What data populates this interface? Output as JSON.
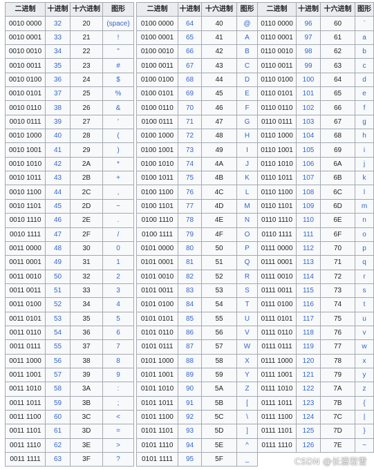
{
  "headers": [
    "二进制",
    "十进制",
    "十六进制",
    "图形"
  ],
  "tables": [
    {
      "rows": [
        [
          "0010 0000",
          "32",
          "20",
          "(space)"
        ],
        [
          "0010 0001",
          "33",
          "21",
          "!"
        ],
        [
          "0010 0010",
          "34",
          "22",
          "\""
        ],
        [
          "0010 0011",
          "35",
          "23",
          "#"
        ],
        [
          "0010 0100",
          "36",
          "24",
          "$"
        ],
        [
          "0010 0101",
          "37",
          "25",
          "%"
        ],
        [
          "0010 0110",
          "38",
          "26",
          "&"
        ],
        [
          "0010 0111",
          "39",
          "27",
          "'"
        ],
        [
          "0010 1000",
          "40",
          "28",
          "("
        ],
        [
          "0010 1001",
          "41",
          "29",
          ")"
        ],
        [
          "0010 1010",
          "42",
          "2A",
          "*"
        ],
        [
          "0010 1011",
          "43",
          "2B",
          "+"
        ],
        [
          "0010 1100",
          "44",
          "2C",
          ","
        ],
        [
          "0010 1101",
          "45",
          "2D",
          "−"
        ],
        [
          "0010 1110",
          "46",
          "2E",
          "."
        ],
        [
          "0010 1111",
          "47",
          "2F",
          "/"
        ],
        [
          "0011 0000",
          "48",
          "30",
          "0"
        ],
        [
          "0011 0001",
          "49",
          "31",
          "1"
        ],
        [
          "0011 0010",
          "50",
          "32",
          "2"
        ],
        [
          "0011 0011",
          "51",
          "33",
          "3"
        ],
        [
          "0011 0100",
          "52",
          "34",
          "4"
        ],
        [
          "0011 0101",
          "53",
          "35",
          "5"
        ],
        [
          "0011 0110",
          "54",
          "36",
          "6"
        ],
        [
          "0011 0111",
          "55",
          "37",
          "7"
        ],
        [
          "0011 1000",
          "56",
          "38",
          "8"
        ],
        [
          "0011 1001",
          "57",
          "39",
          "9"
        ],
        [
          "0011 1010",
          "58",
          "3A",
          ":"
        ],
        [
          "0011 1011",
          "59",
          "3B",
          ";"
        ],
        [
          "0011 1100",
          "60",
          "3C",
          "<"
        ],
        [
          "0011 1101",
          "61",
          "3D",
          "="
        ],
        [
          "0011 1110",
          "62",
          "3E",
          ">"
        ],
        [
          "0011 1111",
          "63",
          "3F",
          "?"
        ]
      ]
    },
    {
      "rows": [
        [
          "0100 0000",
          "64",
          "40",
          "@"
        ],
        [
          "0100 0001",
          "65",
          "41",
          "A"
        ],
        [
          "0100 0010",
          "66",
          "42",
          "B"
        ],
        [
          "0100 0011",
          "67",
          "43",
          "C"
        ],
        [
          "0100 0100",
          "68",
          "44",
          "D"
        ],
        [
          "0100 0101",
          "69",
          "45",
          "E"
        ],
        [
          "0100 0110",
          "70",
          "46",
          "F"
        ],
        [
          "0100 0111",
          "71",
          "47",
          "G"
        ],
        [
          "0100 1000",
          "72",
          "48",
          "H"
        ],
        [
          "0100 1001",
          "73",
          "49",
          "I"
        ],
        [
          "0100 1010",
          "74",
          "4A",
          "J"
        ],
        [
          "0100 1011",
          "75",
          "4B",
          "K"
        ],
        [
          "0100 1100",
          "76",
          "4C",
          "L"
        ],
        [
          "0100 1101",
          "77",
          "4D",
          "M"
        ],
        [
          "0100 1110",
          "78",
          "4E",
          "N"
        ],
        [
          "0100 1111",
          "79",
          "4F",
          "O"
        ],
        [
          "0101 0000",
          "80",
          "50",
          "P"
        ],
        [
          "0101 0001",
          "81",
          "51",
          "Q"
        ],
        [
          "0101 0010",
          "82",
          "52",
          "R"
        ],
        [
          "0101 0011",
          "83",
          "53",
          "S"
        ],
        [
          "0101 0100",
          "84",
          "54",
          "T"
        ],
        [
          "0101 0101",
          "85",
          "55",
          "U"
        ],
        [
          "0101 0110",
          "86",
          "56",
          "V"
        ],
        [
          "0101 0111",
          "87",
          "57",
          "W"
        ],
        [
          "0101 1000",
          "88",
          "58",
          "X"
        ],
        [
          "0101 1001",
          "89",
          "59",
          "Y"
        ],
        [
          "0101 1010",
          "90",
          "5A",
          "Z"
        ],
        [
          "0101 1011",
          "91",
          "5B",
          "["
        ],
        [
          "0101 1100",
          "92",
          "5C",
          "\\"
        ],
        [
          "0101 1101",
          "93",
          "5D",
          "]"
        ],
        [
          "0101 1110",
          "94",
          "5E",
          "^"
        ],
        [
          "0101 1111",
          "95",
          "5F",
          "_"
        ]
      ]
    },
    {
      "rows": [
        [
          "0110 0000",
          "96",
          "60",
          "`"
        ],
        [
          "0110 0001",
          "97",
          "61",
          "a"
        ],
        [
          "0110 0010",
          "98",
          "62",
          "b"
        ],
        [
          "0110 0011",
          "99",
          "63",
          "c"
        ],
        [
          "0110 0100",
          "100",
          "64",
          "d"
        ],
        [
          "0110 0101",
          "101",
          "65",
          "e"
        ],
        [
          "0110 0110",
          "102",
          "66",
          "f"
        ],
        [
          "0110 0111",
          "103",
          "67",
          "g"
        ],
        [
          "0110 1000",
          "104",
          "68",
          "h"
        ],
        [
          "0110 1001",
          "105",
          "69",
          "i"
        ],
        [
          "0110 1010",
          "106",
          "6A",
          "j"
        ],
        [
          "0110 1011",
          "107",
          "6B",
          "k"
        ],
        [
          "0110 1100",
          "108",
          "6C",
          "l"
        ],
        [
          "0110 1101",
          "109",
          "6D",
          "m"
        ],
        [
          "0110 1110",
          "110",
          "6E",
          "n"
        ],
        [
          "0110 1111",
          "111",
          "6F",
          "o"
        ],
        [
          "0111 0000",
          "112",
          "70",
          "p"
        ],
        [
          "0111 0001",
          "113",
          "71",
          "q"
        ],
        [
          "0111 0010",
          "114",
          "72",
          "r"
        ],
        [
          "0111 0011",
          "115",
          "73",
          "s"
        ],
        [
          "0111 0100",
          "116",
          "74",
          "t"
        ],
        [
          "0111 0101",
          "117",
          "75",
          "u"
        ],
        [
          "0111 0110",
          "118",
          "76",
          "v"
        ],
        [
          "0111 0111",
          "119",
          "77",
          "w"
        ],
        [
          "0111 1000",
          "120",
          "78",
          "x"
        ],
        [
          "0111 1001",
          "121",
          "79",
          "y"
        ],
        [
          "0111 1010",
          "122",
          "7A",
          "z"
        ],
        [
          "0111 1011",
          "123",
          "7B",
          "{"
        ],
        [
          "0111 1100",
          "124",
          "7C",
          "|"
        ],
        [
          "0111 1101",
          "125",
          "7D",
          "}"
        ],
        [
          "0111 1110",
          "126",
          "7E",
          "~"
        ]
      ]
    }
  ],
  "watermark": "CSDN @长潇若雪"
}
